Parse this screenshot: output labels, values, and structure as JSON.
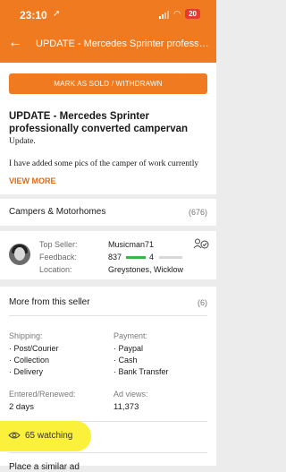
{
  "status_bar": {
    "time": "23:10",
    "location_icon": "location-arrow-icon",
    "battery": "20",
    "battery_color": "#e23b36"
  },
  "app_bar": {
    "back_icon": "arrow-left-icon",
    "title": "UPDATE - Mercedes Sprinter professiona..."
  },
  "colors": {
    "accent": "#f07a20",
    "link": "#e46a12",
    "highlight": "#fbf03a",
    "feedback_bar": "#39b54a"
  },
  "actions": {
    "mark_sold": "MARK AS SOLD / WITHDRAWN"
  },
  "ad": {
    "title": "UPDATE - Mercedes Sprinter professionally converted campervan",
    "description_lines": [
      "Update.",
      "I have added some pics of the camper of work  currently"
    ],
    "view_more": "VIEW MORE"
  },
  "category": {
    "label": "Campers & Motorhomes",
    "count": "(676)"
  },
  "seller": {
    "top_seller_label": "Top Seller:",
    "top_seller_value": "Musicman71",
    "feedback_label": "Feedback:",
    "feedback_positive": "837",
    "feedback_negative": "4",
    "location_label": "Location:",
    "location_value": "Greystones, Wicklow",
    "icon": "user-check-icon"
  },
  "more_from_seller": {
    "label": "More from this seller",
    "count": "(6)"
  },
  "shipping": {
    "label": "Shipping:",
    "items": [
      "· Post/Courier",
      "· Collection",
      "· Delivery"
    ]
  },
  "payment": {
    "label": "Payment:",
    "items": [
      "· Paypal",
      "· Cash",
      "· Bank Transfer"
    ]
  },
  "stats": {
    "entered_label": "Entered/Renewed:",
    "entered_value": "2 days",
    "views_label": "Ad views:",
    "views_value": "11,373"
  },
  "watching": {
    "icon": "eye-icon",
    "text": "65 watching"
  },
  "similar": {
    "label": "Place a similar ad"
  }
}
